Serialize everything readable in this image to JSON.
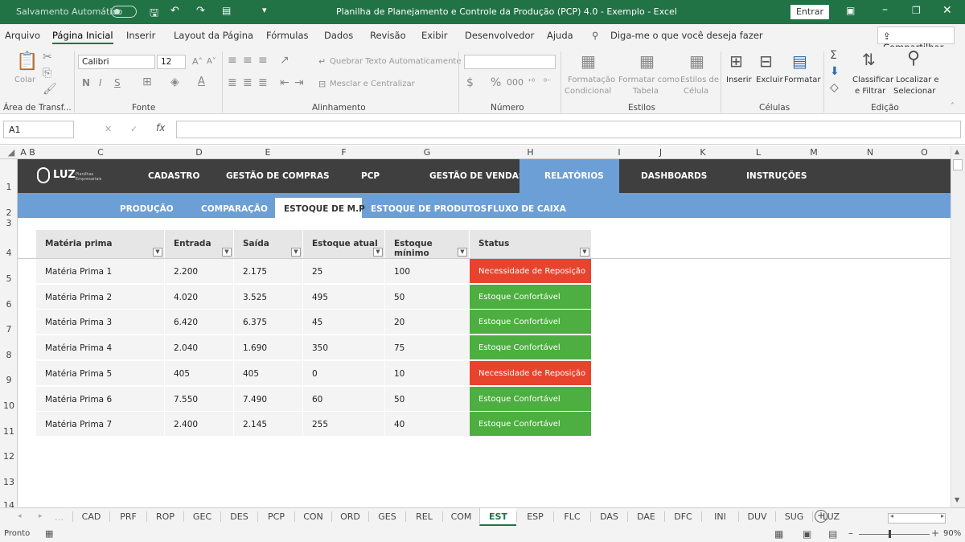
{
  "titlebar": {
    "autosave": "Salvamento Automático",
    "title": "Planilha de Planejamento e Controle da Produção (PCP) 4.0 - Exemplo  -  Excel",
    "signin": "Entrar"
  },
  "menu": [
    "Arquivo",
    "Página Inicial",
    "Inserir",
    "Layout da Página",
    "Fórmulas",
    "Dados",
    "Revisão",
    "Exibir",
    "Desenvolvedor",
    "Ajuda"
  ],
  "tellme": "Diga-me o que você deseja fazer",
  "share": "Compartilhar",
  "ribbon": {
    "paste": "Colar",
    "clipboard": "Área de Transf...",
    "font_name": "Calibri",
    "font_size": "12",
    "font_group": "Fonte",
    "wrap": "Quebrar Texto Automaticamente",
    "merge": "Mesclar e Centralizar",
    "align_group": "Alinhamento",
    "number_group": "Número",
    "cond1": "Formatação",
    "cond2": "Condicional",
    "fmt_table1": "Formatar como",
    "fmt_table2": "Tabela",
    "cell_styles1": "Estilos de",
    "cell_styles2": "Célula",
    "styles_group": "Estilos",
    "insert": "Inserir",
    "delete": "Excluir",
    "format": "Formatar",
    "cells_group": "Células",
    "sort1": "Classificar",
    "sort2": "e Filtrar",
    "find1": "Localizar e",
    "find2": "Selecionar",
    "edit_group": "Edição"
  },
  "namebox": "A1",
  "columns": [
    "A",
    "B",
    "C",
    "D",
    "E",
    "F",
    "G",
    "H",
    "I",
    "J",
    "K",
    "L",
    "M",
    "N",
    "O"
  ],
  "rows": [
    "1",
    "2",
    "3",
    "4",
    "5",
    "6",
    "7",
    "8",
    "9",
    "10",
    "11",
    "12",
    "13",
    "14"
  ],
  "nav": [
    "CADASTRO",
    "GESTÃO DE COMPRAS",
    "PCP",
    "GESTÃO DE VENDAS",
    "RELATÓRIOS",
    "DASHBOARDS",
    "INSTRUÇÕES"
  ],
  "logo": {
    "name": "LUZ",
    "tagline": "Planilhas Empresariais"
  },
  "subnav": [
    "PRODUÇÃO",
    "COMPARAÇÃO",
    "ESTOQUE DE M.P",
    "ESTOQUE DE PRODUTOS",
    "FLUXO DE CAIXA"
  ],
  "table": {
    "headers": [
      "Matéria prima",
      "Entrada",
      "Saída",
      "Estoque atual",
      "Estoque mínimo",
      "Status"
    ],
    "rows": [
      [
        "Matéria Prima 1",
        "2.200",
        "2.175",
        "25",
        "100",
        "Necessidade de Reposição"
      ],
      [
        "Matéria Prima 2",
        "4.020",
        "3.525",
        "495",
        "50",
        "Estoque Confortável"
      ],
      [
        "Matéria Prima 3",
        "6.420",
        "6.375",
        "45",
        "20",
        "Estoque Confortável"
      ],
      [
        "Matéria Prima 4",
        "2.040",
        "1.690",
        "350",
        "75",
        "Estoque Confortável"
      ],
      [
        "Matéria Prima 5",
        "405",
        "405",
        "0",
        "10",
        "Necessidade de Reposição"
      ],
      [
        "Matéria Prima 6",
        "7.550",
        "7.490",
        "60",
        "50",
        "Estoque Confortável"
      ],
      [
        "Matéria Prima 7",
        "2.400",
        "2.145",
        "255",
        "40",
        "Estoque Confortável"
      ]
    ]
  },
  "colors": {
    "red": "#e8432d",
    "green": "#4caf3f",
    "excel_green": "#217346"
  },
  "tabs": [
    "CAD",
    "PRF",
    "ROP",
    "GEC",
    "DES",
    "PCP",
    "CON",
    "ORD",
    "GES",
    "REL",
    "COM",
    "EST",
    "ESP",
    "FLC",
    "DAS",
    "DAE",
    "DFC",
    "INI",
    "DUV",
    "SUG",
    "LUZ"
  ],
  "status": {
    "ready": "Pronto",
    "zoom": "90%"
  }
}
